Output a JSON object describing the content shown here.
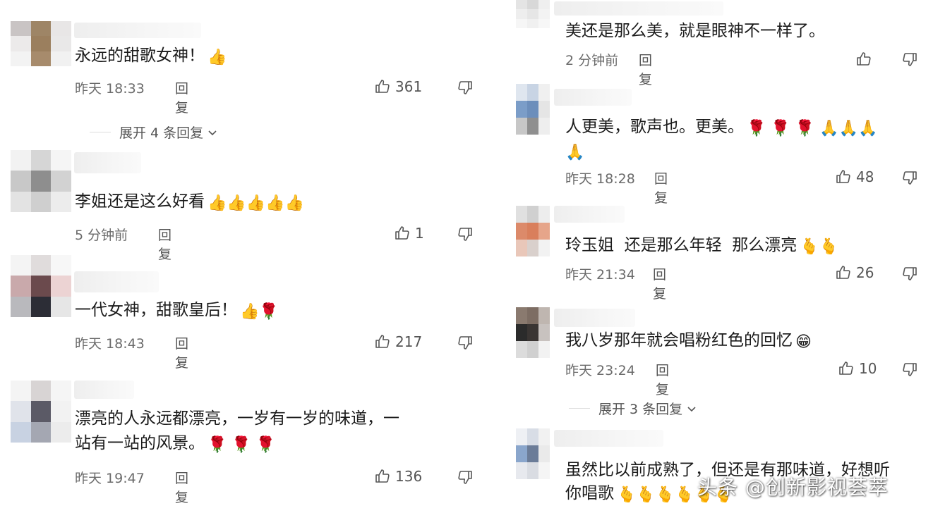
{
  "left": [
    {
      "text": "永远的甜歌女神！",
      "emoji": "👍",
      "time": "昨天 18:33",
      "reply": "回复",
      "likes": "361"
    },
    {
      "text": "李姐还是这么好看",
      "emoji": "👍👍👍👍👍",
      "time": "5 分钟前",
      "reply": "回复",
      "likes": "1"
    },
    {
      "text": "一代女神，甜歌皇后！",
      "emoji": "👍🌹",
      "time": "昨天 18:43",
      "reply": "回复",
      "likes": "217"
    },
    {
      "line1": "漂亮的人永远都漂亮，一岁有一岁的味道，一",
      "line2": "站有一站的风景。",
      "emoji": "🌹 🌹 🌹",
      "time": "昨天 19:47",
      "reply": "回复",
      "likes": "136"
    }
  ],
  "left_expand": "展开 4 条回复",
  "right": [
    {
      "text": "美还是那么美，就是眼神不一样了。",
      "time": "2 分钟前",
      "reply": "回复",
      "likes": ""
    },
    {
      "text": "人更美，歌声也。更美。",
      "emoji": "🌹 🌹 🌹 🙏🙏🙏",
      "emoji2": "🙏",
      "time": "昨天 18:28",
      "reply": "回复",
      "likes": "48"
    },
    {
      "text": "玲玉姐  还是那么年轻  那么漂亮",
      "emoji": "🫰🫰",
      "time": "昨天 21:34",
      "reply": "回复",
      "likes": "26"
    },
    {
      "text": "我八岁那年就会唱粉红色的回忆",
      "emoji": "😁",
      "time": "昨天 23:24",
      "reply": "回复",
      "likes": "10"
    },
    {
      "line1": "虽然比以前成熟了，但还是有那味道，好想听",
      "line2": "你唱歌",
      "emoji": "🫰🫰🫰🫰🫰🫰"
    }
  ],
  "right_expand": "展开 3 条回复",
  "watermark": "头条 @创新影视荟萃",
  "icons": {
    "like": "thumb-up-icon",
    "dislike": "thumb-down-icon",
    "expand": "chevron-down-icon"
  },
  "colors": {
    "text": "#1b1b1b",
    "meta": "#6b6b6b",
    "like": "#555555"
  }
}
